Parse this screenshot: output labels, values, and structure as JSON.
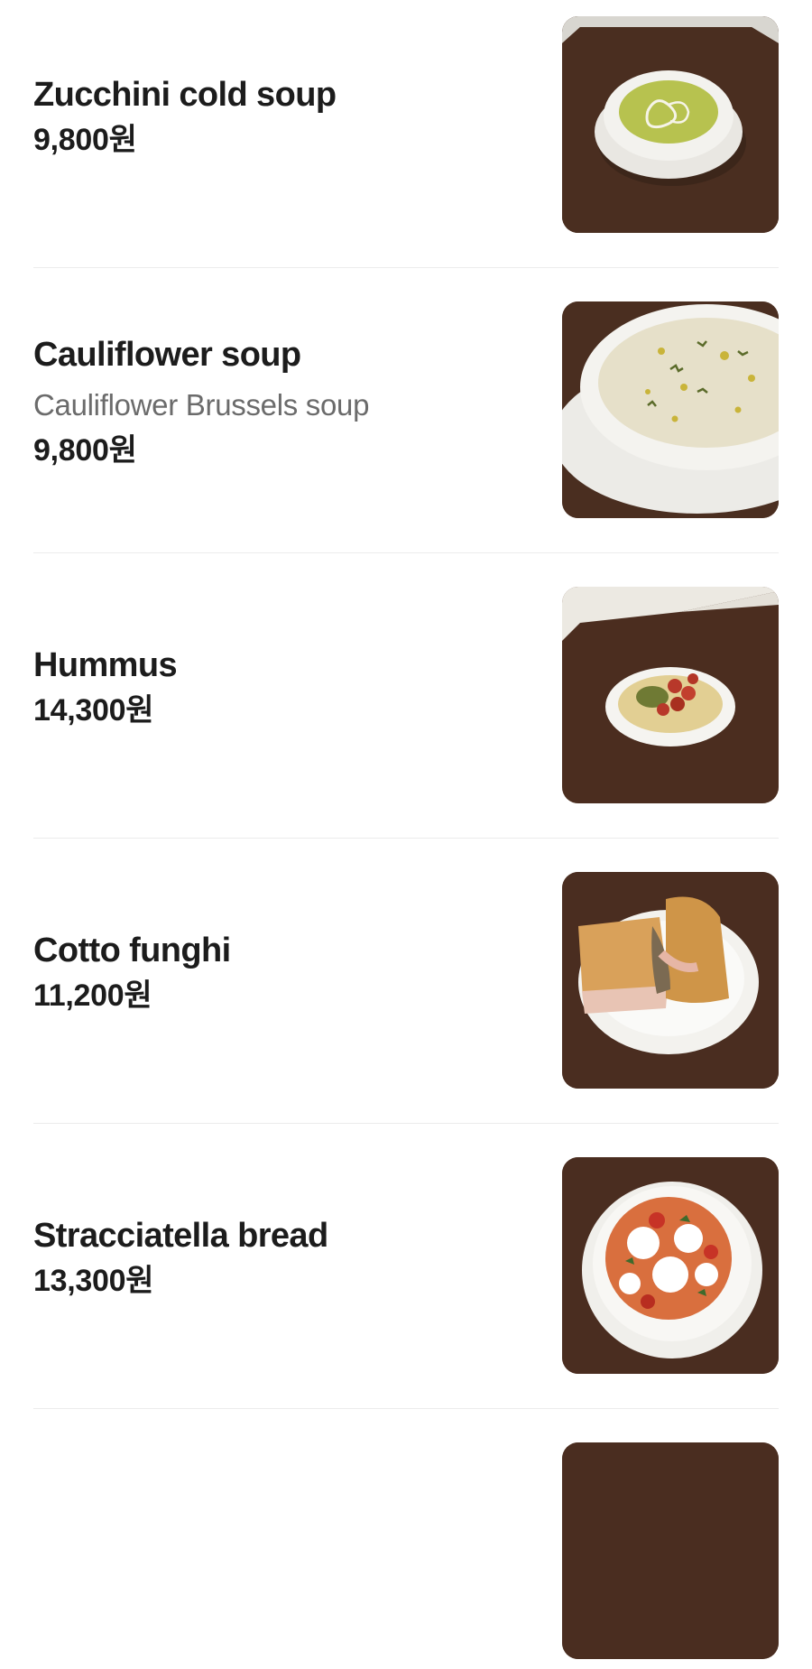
{
  "menu": {
    "items": [
      {
        "name": "Zucchini cold soup",
        "description": "",
        "price": "9,800원",
        "image": "zucchini-soup-photo"
      },
      {
        "name": "Cauliflower soup",
        "description": "Cauliflower Brussels soup",
        "price": "9,800원",
        "image": "cauliflower-soup-photo"
      },
      {
        "name": "Hummus",
        "description": "",
        "price": "14,300원",
        "image": "hummus-photo"
      },
      {
        "name": "Cotto funghi",
        "description": "",
        "price": "11,200원",
        "image": "sandwich-photo"
      },
      {
        "name": "Stracciatella bread",
        "description": "",
        "price": "13,300원",
        "image": "stracciatella-photo"
      }
    ]
  },
  "colors": {
    "title_text": "#1c1c1c",
    "description_text": "#6b6b6b",
    "divider": "#ececec",
    "table_wood": "#4a2f21"
  }
}
